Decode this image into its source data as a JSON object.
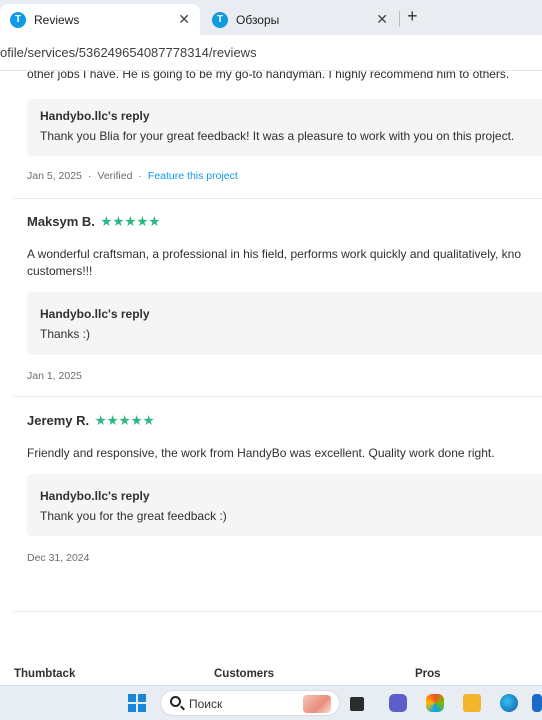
{
  "browser": {
    "tabs": [
      {
        "label": "Reviews",
        "active": true
      },
      {
        "label": "Обзоры",
        "active": false
      }
    ],
    "close_glyph": "✕",
    "new_tab_glyph": "+",
    "favicon_letter": "T",
    "url": "ofile/services/536249654087778314/reviews"
  },
  "reviews": {
    "previous_tail": "other jobs I have. He is going to be my go-to handyman. I highly recommend him to others.",
    "previous_reply": {
      "title": "Handybo.llc's reply",
      "text": "Thank you Blia for your great feedback! It was a pleasure to work with you on this project."
    },
    "previous_meta": {
      "date": "Jan 5, 2025",
      "sep": "·",
      "verified": "Verified",
      "link": "Feature this project"
    },
    "items": [
      {
        "name": "Maksym B.",
        "rating": 5,
        "text_line1": "A wonderful craftsman, a professional in his field, performs work quickly and qualitatively, kno",
        "text_line2": "customers!!!",
        "reply_title": "Handybo.llc's reply",
        "reply_text": "Thanks :)",
        "date": "Jan 1, 2025"
      },
      {
        "name": "Jeremy R.",
        "rating": 5,
        "text_line1": "Friendly and responsive, the work from HandyBo was excellent. Quality work done right.",
        "reply_title": "Handybo.llc's reply",
        "reply_text": "Thank you for the great feedback :)",
        "date": "Dec 31, 2024"
      }
    ]
  },
  "footer": {
    "columns": [
      "Thumbtack",
      "Customers",
      "Pros"
    ]
  },
  "taskbar": {
    "search_label": "Поиск",
    "icons": [
      "windows-start-icon",
      "search-icon",
      "task-view-icon",
      "teams-icon",
      "copilot-icon",
      "file-explorer-icon",
      "edge-icon",
      "app-icon"
    ]
  },
  "colors": {
    "accent": "#0f9ae6",
    "star": "#2db783",
    "reply_bg": "#f5f5f5"
  }
}
